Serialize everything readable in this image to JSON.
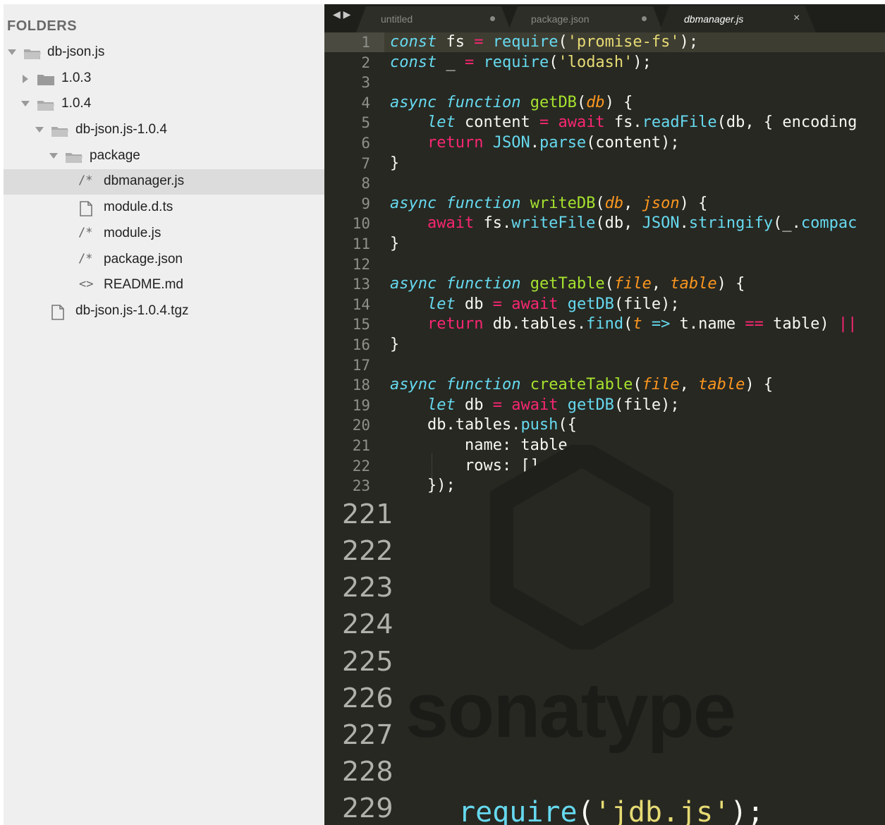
{
  "sidebar": {
    "title": "FOLDERS",
    "items": [
      {
        "label": "db-json.js",
        "icon": "folder-open-icon",
        "state": "expanded"
      },
      {
        "label": "1.0.3",
        "icon": "folder-closed-icon",
        "state": "collapsed"
      },
      {
        "label": "1.0.4",
        "icon": "folder-open-icon",
        "state": "expanded"
      },
      {
        "label": "db-json.js-1.0.4",
        "icon": "folder-open-icon",
        "state": "expanded"
      },
      {
        "label": "package",
        "icon": "folder-open-icon",
        "state": "expanded"
      },
      {
        "label": "dbmanager.js",
        "icon": "/*",
        "state": "selected"
      },
      {
        "label": "module.d.ts",
        "icon": "file-icon",
        "state": "file"
      },
      {
        "label": "module.js",
        "icon": "/*",
        "state": "file"
      },
      {
        "label": "package.json",
        "icon": "/*",
        "state": "file"
      },
      {
        "label": "README.md",
        "icon": "<>",
        "state": "file"
      },
      {
        "label": "db-json.js-1.0.4.tgz",
        "icon": "file-icon",
        "state": "file"
      }
    ]
  },
  "tabs": [
    {
      "label": "untitled",
      "modified": true,
      "active": false
    },
    {
      "label": "package.json",
      "modified": true,
      "active": false
    },
    {
      "label": "dbmanager.js",
      "modified": false,
      "active": true,
      "close": "×"
    }
  ],
  "code_lines": [
    "1",
    "2",
    "3",
    "4",
    "5",
    "6",
    "7",
    "8",
    "9",
    "10",
    "11",
    "12",
    "13",
    "14",
    "15",
    "16",
    "17",
    "18",
    "19",
    "20",
    "21",
    "22",
    "23"
  ],
  "big_lines": [
    {
      "n": "221",
      "code": ""
    },
    {
      "n": "222",
      "code": ""
    },
    {
      "n": "223",
      "code": ""
    },
    {
      "n": "224",
      "code": ""
    },
    {
      "n": "225",
      "code": ""
    },
    {
      "n": "226",
      "code": ""
    },
    {
      "n": "227",
      "code": ""
    },
    {
      "n": "228",
      "code": ""
    },
    {
      "n": "229",
      "code": "require('jdb.js');"
    }
  ],
  "watermark": "sonatype",
  "colors": {
    "editor_bg": "#272822",
    "keyword": "#66d9ef",
    "operator": "#f92672",
    "function": "#a6e22e",
    "string": "#e6db74",
    "param": "#fd971f"
  }
}
